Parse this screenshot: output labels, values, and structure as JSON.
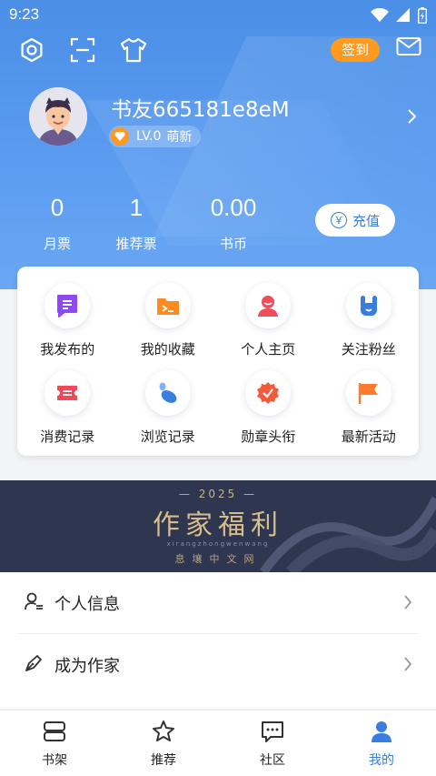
{
  "status_bar": {
    "time": "9:23"
  },
  "header": {
    "signin_label": "签到"
  },
  "profile": {
    "username": "书友665181e8eM",
    "level": "LV.0",
    "level_name": "萌新"
  },
  "stats": [
    {
      "value": "0",
      "label": "月票"
    },
    {
      "value": "1",
      "label": "推荐票"
    },
    {
      "value": "0.00",
      "label": "书币"
    }
  ],
  "recharge": {
    "label": "充值",
    "symbol": "¥"
  },
  "grid": [
    {
      "label": "我发布的",
      "icon": "document-icon",
      "color": "#8e49f5"
    },
    {
      "label": "我的收藏",
      "icon": "folder-icon",
      "color": "#ff8a1f"
    },
    {
      "label": "个人主页",
      "icon": "person-icon",
      "color": "#f24c5a"
    },
    {
      "label": "关注粉丝",
      "icon": "rock-hand-icon",
      "color": "#3a7de0"
    },
    {
      "label": "消费记录",
      "icon": "ticket-icon",
      "color": "#f04a5a"
    },
    {
      "label": "浏览记录",
      "icon": "footprint-icon",
      "color": "#3a7de0"
    },
    {
      "label": "勋章头衔",
      "icon": "medal-icon",
      "color": "#f25a3a"
    },
    {
      "label": "最新活动",
      "icon": "flag-icon",
      "color": "#ff7a2a"
    }
  ],
  "banner": {
    "year": "2025",
    "title": "作家福利",
    "pinyin": "xirangzhongwenwang",
    "subtitle": "息壤中文网"
  },
  "menu": [
    {
      "label": "个人信息",
      "icon": "user-info-icon"
    },
    {
      "label": "成为作家",
      "icon": "pen-icon"
    }
  ],
  "tabs": [
    {
      "label": "书架",
      "icon": "bookshelf-icon"
    },
    {
      "label": "推荐",
      "icon": "star-icon"
    },
    {
      "label": "社区",
      "icon": "chat-icon"
    },
    {
      "label": "我的",
      "icon": "me-icon",
      "active": true
    }
  ],
  "colors": {
    "primary": "#3a7de0",
    "hero": "#5b9cf0",
    "signin": "#ff9a1f"
  }
}
